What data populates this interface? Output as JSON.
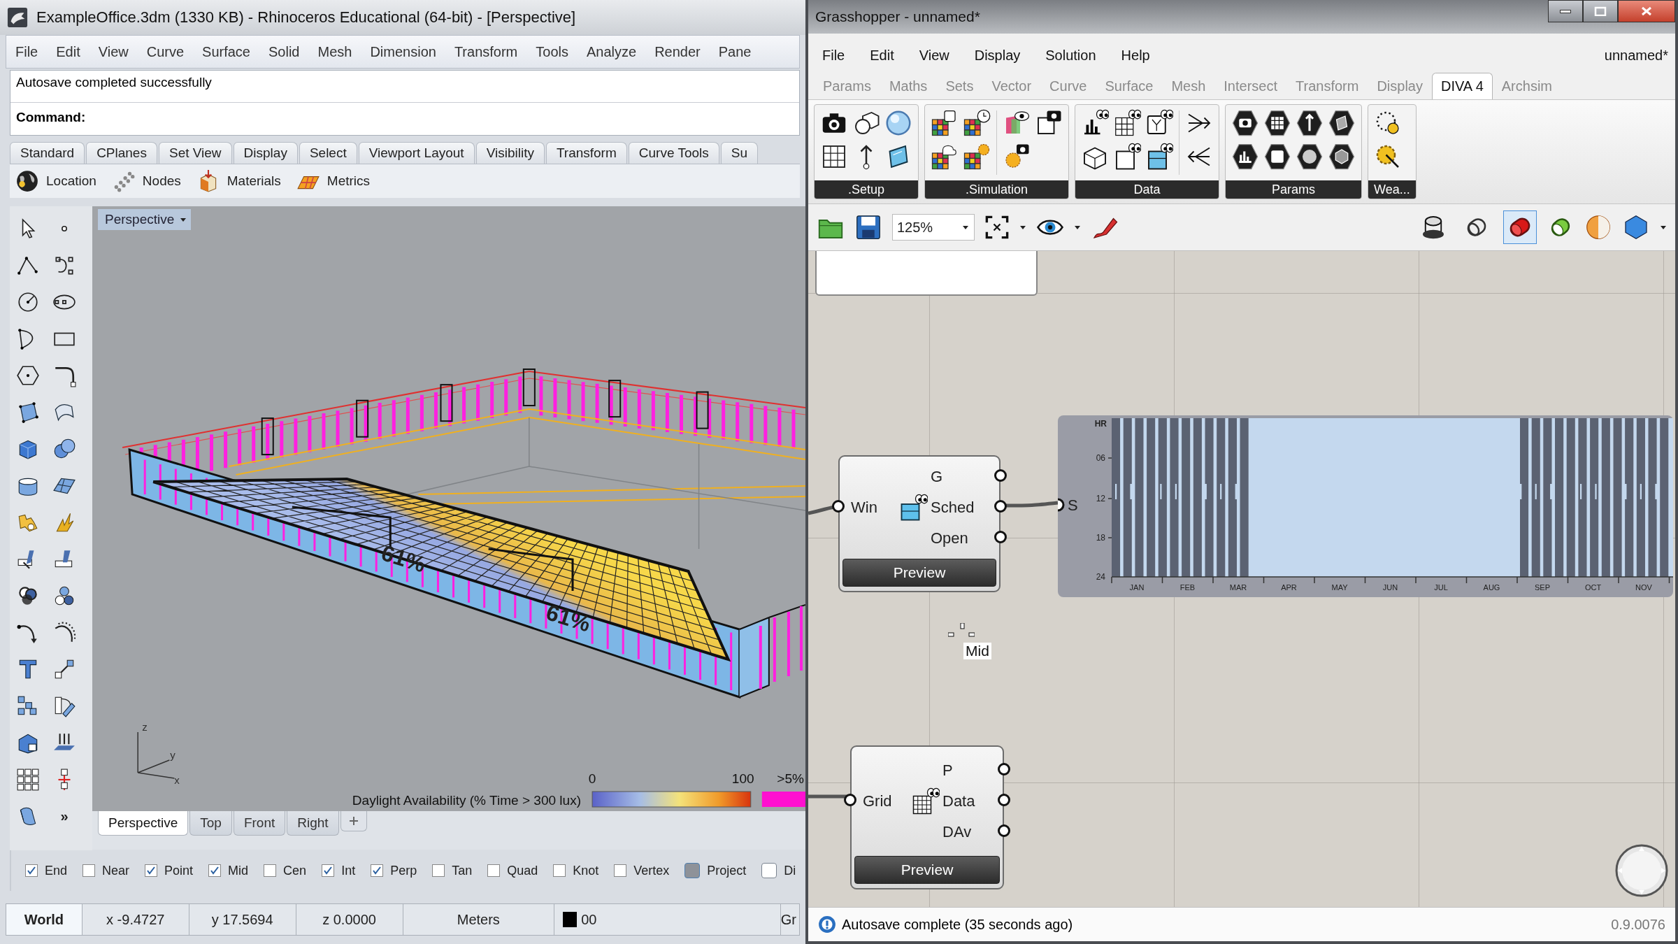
{
  "rhino_window": {
    "title": "ExampleOffice.3dm (1330 KB) - Rhinoceros Educational (64-bit) - [Perspective]",
    "menu": [
      "File",
      "Edit",
      "View",
      "Curve",
      "Surface",
      "Solid",
      "Mesh",
      "Dimension",
      "Transform",
      "Tools",
      "Analyze",
      "Render",
      "Pane"
    ],
    "command_history": "Autosave completed successfully",
    "command_prompt": "Command:",
    "toolbar_tabs": [
      "Standard",
      "CPlanes",
      "Set View",
      "Display",
      "Select",
      "Viewport Layout",
      "Visibility",
      "Transform",
      "Curve Tools",
      "Su"
    ],
    "toolbar_buttons": [
      "Location",
      "Nodes",
      "Materials",
      "Metrics"
    ],
    "more_tools": "»",
    "viewport": {
      "title": "Perspective",
      "labels": [
        "61%",
        "61%"
      ],
      "axes": [
        "z",
        "y",
        "x"
      ],
      "legend": {
        "title": "Daylight Availability (% Time > 300 lux)",
        "min": "0",
        "max": "100",
        "over": ">5%"
      }
    },
    "view_tabs": [
      {
        "label": "Perspective",
        "selected": true
      },
      {
        "label": "Top",
        "selected": false
      },
      {
        "label": "Front",
        "selected": false
      },
      {
        "label": "Right",
        "selected": false
      }
    ],
    "osnaps": [
      {
        "label": "End",
        "kind": "checkbox",
        "checked": true
      },
      {
        "label": "Near",
        "kind": "checkbox",
        "checked": false
      },
      {
        "label": "Point",
        "kind": "checkbox",
        "checked": true
      },
      {
        "label": "Mid",
        "kind": "checkbox",
        "checked": true
      },
      {
        "label": "Cen",
        "kind": "checkbox",
        "checked": false
      },
      {
        "label": "Int",
        "kind": "checkbox",
        "checked": true
      },
      {
        "label": "Perp",
        "kind": "checkbox",
        "checked": true
      },
      {
        "label": "Tan",
        "kind": "checkbox",
        "checked": false
      },
      {
        "label": "Quad",
        "kind": "checkbox",
        "checked": false
      },
      {
        "label": "Knot",
        "kind": "checkbox",
        "checked": false
      },
      {
        "label": "Vertex",
        "kind": "checkbox",
        "checked": false
      },
      {
        "label": "Project",
        "kind": "toggle",
        "on": true
      },
      {
        "label": "Di",
        "kind": "toggle",
        "on": false
      }
    ],
    "status_bar": [
      {
        "kind": "cplane",
        "text": "World"
      },
      {
        "kind": "coordinate",
        "text": "x -9.4727"
      },
      {
        "kind": "coordinate",
        "text": "y 17.5694"
      },
      {
        "kind": "coordinate",
        "text": "z 0.0000"
      },
      {
        "kind": "units",
        "text": "Meters"
      },
      {
        "kind": "layer",
        "text": "00"
      },
      {
        "kind": "grid",
        "text": "Gr"
      }
    ]
  },
  "grasshopper_window": {
    "title": "Grasshopper - unnamed*",
    "menu": [
      "File",
      "Edit",
      "View",
      "Display",
      "Solution",
      "Help"
    ],
    "document_name": "unnamed*",
    "tabs": [
      {
        "label": "Params",
        "selected": false
      },
      {
        "label": "Maths",
        "selected": false
      },
      {
        "label": "Sets",
        "selected": false
      },
      {
        "label": "Vector",
        "selected": false
      },
      {
        "label": "Curve",
        "selected": false
      },
      {
        "label": "Surface",
        "selected": false
      },
      {
        "label": "Mesh",
        "selected": false
      },
      {
        "label": "Intersect",
        "selected": false
      },
      {
        "label": "Transform",
        "selected": false
      },
      {
        "label": "Display",
        "selected": false
      },
      {
        "label": "DIVA 4",
        "selected": true
      },
      {
        "label": "Archsim",
        "selected": false
      }
    ],
    "ribbon_groups": [
      ".Setup",
      ".Simulation",
      "Data",
      "Params",
      "Wea..."
    ],
    "zoom": "125%",
    "display_modes": [
      {
        "selected": false
      },
      {
        "selected": false
      },
      {
        "selected": true
      }
    ],
    "components": [
      {
        "inputs": [
          "Win"
        ],
        "outputs": [
          "G",
          "Sched",
          "Open"
        ],
        "button": "Preview"
      },
      {
        "inputs": [
          "Grid"
        ],
        "outputs": [
          "P",
          "Data",
          "DAv"
        ],
        "button": "Preview"
      }
    ],
    "schedule_viewer": {
      "input": "S",
      "hour_label": "HR",
      "hour_ticks": [
        "06",
        "12",
        "18",
        "24"
      ],
      "months": [
        "JAN",
        "FEB",
        "MAR",
        "APR",
        "MAY",
        "JUN",
        "JUL",
        "AUG",
        "SEP",
        "OCT",
        "NOV"
      ]
    },
    "snap_label": "Mid",
    "status_message": "Autosave complete (35 seconds ago)",
    "version": "0.9.0076"
  }
}
